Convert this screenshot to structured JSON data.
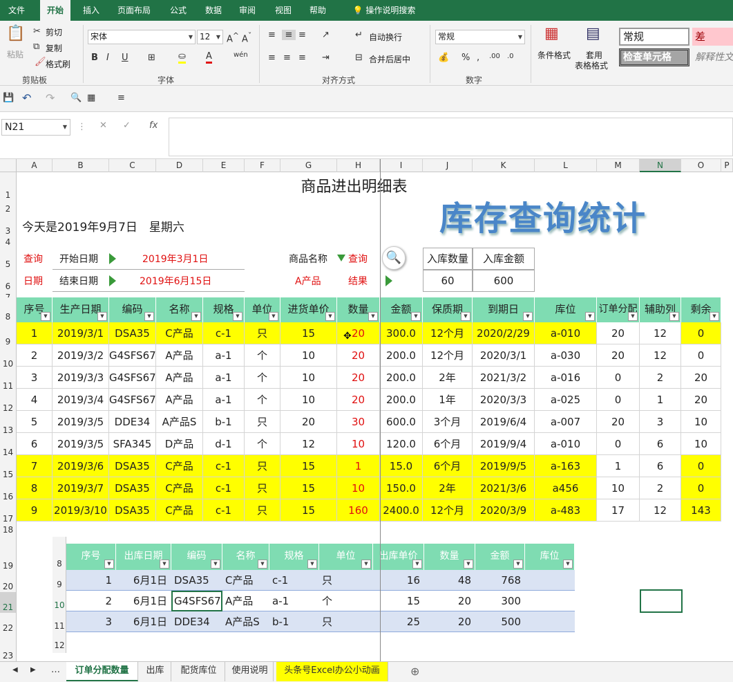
{
  "ribbon_tabs": [
    "文件",
    "开始",
    "插入",
    "页面布局",
    "公式",
    "数据",
    "审阅",
    "视图",
    "帮助",
    "操作说明搜索"
  ],
  "ribbon": {
    "paste": "粘贴",
    "cut": "剪切",
    "copy": "复制",
    "format_painter": "格式刷",
    "clipboard_label": "剪贴板",
    "font_name": "宋体",
    "font_size": "12",
    "font_label": "字体",
    "wrap_text": "自动换行",
    "merge_center": "合并后居中",
    "alignment_label": "对齐方式",
    "number_format": "常规",
    "number_label": "数字",
    "cond_format": "条件格式",
    "table_format_1": "套用",
    "table_format_2": "表格格式",
    "style_normal": "常规",
    "style_bad": "差",
    "style_check": "检查单元格",
    "style_explain": "解释性文"
  },
  "name_box": "N21",
  "column_headers": [
    "A",
    "B",
    "C",
    "D",
    "E",
    "F",
    "G",
    "H",
    "I",
    "J",
    "K",
    "L",
    "M",
    "N",
    "O",
    "P"
  ],
  "row_numbers": [
    "1",
    "2",
    "3",
    "4",
    "5",
    "6",
    "7",
    "8",
    "9",
    "10",
    "11",
    "12",
    "13",
    "14",
    "15",
    "16",
    "17",
    "18",
    "19",
    "20",
    "21",
    "22",
    "23"
  ],
  "report": {
    "title": "商品进出明细表",
    "today": "今天是2019年9月7日　星期六",
    "big_title": "库存查询统计",
    "query_label": "查询",
    "start_label": "开始日期",
    "start_date": "2019年3月1日",
    "period_label": "日期",
    "end_label": "结束日期",
    "end_date": "2019年6月15日",
    "product_label": "商品名称",
    "query_link": "查询",
    "product_value": "A产品",
    "result_label": "结果",
    "in_qty_header": "入库数量",
    "in_amount_header": "入库金额",
    "in_qty": "60",
    "in_amount": "600"
  },
  "main_table": {
    "headers": [
      "序号",
      "生产日期",
      "编码",
      "名称",
      "规格",
      "单位",
      "进货单价",
      "数量",
      "金额",
      "保质期",
      "到期日",
      "库位",
      "订单分配",
      "辅助列",
      "剩余"
    ],
    "rows": [
      [
        "1",
        "2019/3/1",
        "DSA35",
        "C产品",
        "c-1",
        "只",
        "15",
        "20",
        "300.0",
        "12个月",
        "2020/2/29",
        "a-010",
        "20",
        "12",
        "0"
      ],
      [
        "2",
        "2019/3/2",
        "G4SFS67",
        "A产品",
        "a-1",
        "个",
        "10",
        "20",
        "200.0",
        "12个月",
        "2020/3/1",
        "a-030",
        "20",
        "12",
        "0"
      ],
      [
        "3",
        "2019/3/3",
        "G4SFS67",
        "A产品",
        "a-1",
        "个",
        "10",
        "20",
        "200.0",
        "2年",
        "2021/3/2",
        "a-016",
        "0",
        "2",
        "20"
      ],
      [
        "4",
        "2019/3/4",
        "G4SFS67",
        "A产品",
        "a-1",
        "个",
        "10",
        "20",
        "200.0",
        "1年",
        "2020/3/3",
        "a-025",
        "0",
        "1",
        "20"
      ],
      [
        "5",
        "2019/3/5",
        "DDE34",
        "A产品S",
        "b-1",
        "只",
        "20",
        "30",
        "600.0",
        "3个月",
        "2019/6/4",
        "a-007",
        "20",
        "3",
        "10"
      ],
      [
        "6",
        "2019/3/5",
        "SFA345",
        "D产品",
        "d-1",
        "个",
        "12",
        "10",
        "120.0",
        "6个月",
        "2019/9/4",
        "a-010",
        "0",
        "6",
        "10"
      ],
      [
        "7",
        "2019/3/6",
        "DSA35",
        "C产品",
        "c-1",
        "只",
        "15",
        "1",
        "15.0",
        "6个月",
        "2019/9/5",
        "a-163",
        "1",
        "6",
        "0"
      ],
      [
        "8",
        "2019/3/7",
        "DSA35",
        "C产品",
        "c-1",
        "只",
        "15",
        "10",
        "150.0",
        "2年",
        "2021/3/6",
        "a456",
        "10",
        "2",
        "0"
      ],
      [
        "9",
        "2019/3/10",
        "DSA35",
        "C产品",
        "c-1",
        "只",
        "15",
        "160",
        "2400.0",
        "12个月",
        "2020/3/9",
        "a-483",
        "17",
        "12",
        "143"
      ]
    ]
  },
  "out_table": {
    "row_numbers": [
      "8",
      "9",
      "10",
      "11",
      "12"
    ],
    "headers": [
      "序号",
      "出库日期",
      "编码",
      "名称",
      "规格",
      "单位",
      "出库单价",
      "数量",
      "金额",
      "库位"
    ],
    "rows": [
      [
        "1",
        "6月1日",
        "DSA35",
        "C产品",
        "c-1",
        "只",
        "16",
        "48",
        "768",
        ""
      ],
      [
        "2",
        "6月1日",
        "G4SFS67",
        "A产品",
        "a-1",
        "个",
        "15",
        "20",
        "300",
        ""
      ],
      [
        "3",
        "6月1日",
        "DDE34",
        "A产品S",
        "b-1",
        "只",
        "25",
        "20",
        "500",
        ""
      ]
    ]
  },
  "sheet_tabs": [
    "订单分配数量",
    "出库",
    "配货库位",
    "使用说明",
    "头条号Excel办公小动画"
  ],
  "colors": {
    "excel_green": "#217346",
    "header_green": "#7fdcb2",
    "highlight_yellow": "#ffff00",
    "blue_row": "#dae3f3",
    "red": "#e01010"
  }
}
